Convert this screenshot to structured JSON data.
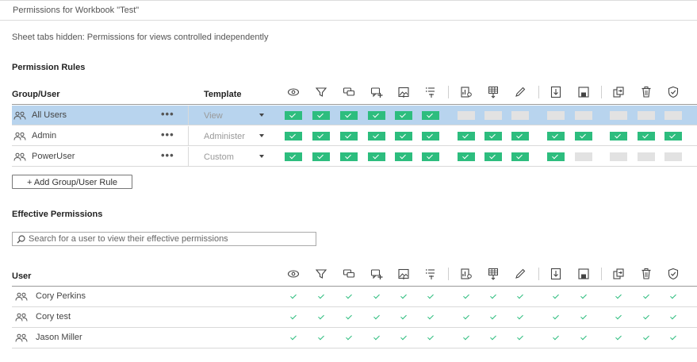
{
  "window_title": "Permissions for Workbook \"Test\"",
  "notice": "Sheet tabs hidden: Permissions for views controlled independently",
  "rules_section": {
    "heading": "Permission Rules",
    "col_group_user": "Group/User",
    "col_template": "Template",
    "rows": [
      {
        "name": "All Users",
        "template": "View",
        "selected": true,
        "caps": [
          "allow",
          "allow",
          "allow",
          "allow",
          "allow",
          "allow",
          "none",
          "none",
          "none",
          "none",
          "none",
          "none",
          "none",
          "none"
        ]
      },
      {
        "name": "Admin",
        "template": "Administer",
        "selected": false,
        "caps": [
          "allow",
          "allow",
          "allow",
          "allow",
          "allow",
          "allow",
          "allow",
          "allow",
          "allow",
          "allow",
          "allow",
          "allow",
          "allow",
          "allow"
        ]
      },
      {
        "name": "PowerUser",
        "template": "Custom",
        "selected": false,
        "caps": [
          "allow",
          "allow",
          "allow",
          "allow",
          "allow",
          "allow",
          "allow",
          "allow",
          "allow",
          "allow",
          "none",
          "none",
          "none",
          "none"
        ]
      }
    ],
    "add_button": "+ Add Group/User Rule"
  },
  "capability_icons": [
    "view-icon",
    "filter-icon",
    "comments-icon",
    "add-comment-icon",
    "export-image-icon",
    "summary-data-icon",
    "view-underlying-data-icon",
    "download-data-icon",
    "web-edit-icon",
    "download-workbook-icon",
    "save-icon",
    "move-icon",
    "delete-icon",
    "set-permissions-icon"
  ],
  "effective_section": {
    "heading": "Effective Permissions",
    "search_placeholder": "Search for a user to view their effective permissions",
    "col_user": "User",
    "users": [
      {
        "name": "Cory Perkins",
        "caps": [
          true,
          true,
          true,
          true,
          true,
          true,
          true,
          true,
          true,
          true,
          true,
          true,
          true,
          true
        ]
      },
      {
        "name": "Cory test",
        "caps": [
          true,
          true,
          true,
          true,
          true,
          true,
          true,
          true,
          true,
          true,
          true,
          true,
          true,
          true
        ]
      },
      {
        "name": "Jason Miller",
        "caps": [
          true,
          true,
          true,
          true,
          true,
          true,
          true,
          true,
          true,
          true,
          true,
          true,
          true,
          true
        ]
      }
    ]
  },
  "colors": {
    "allowed": "#2dbd7e",
    "unspecified": "#e2e2e2",
    "selected_row": "#b8d4ee"
  }
}
